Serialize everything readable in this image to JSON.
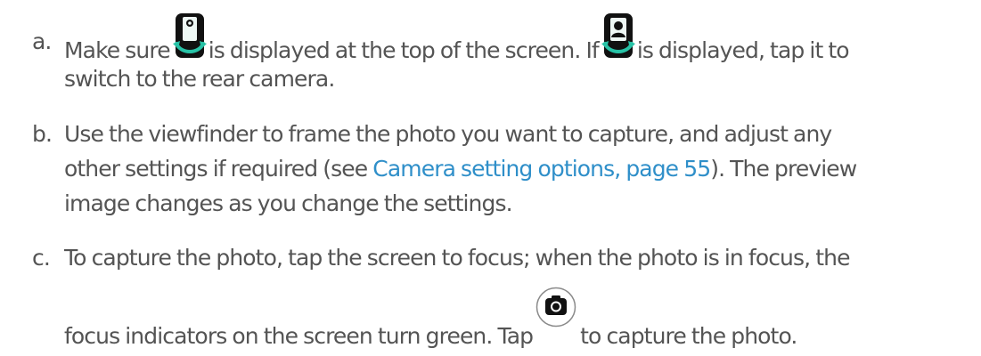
{
  "steps": [
    {
      "marker": "a.",
      "line1": {
        "part1": "Make sure",
        "part2": "is displayed at the top of the screen. If",
        "part3": "is displayed, tap it to"
      },
      "line2": "switch to the rear camera.",
      "icons": [
        "rear-camera-switch-icon",
        "front-camera-switch-icon"
      ]
    },
    {
      "marker": "b.",
      "line1": "Use the viewfinder to frame the photo you want to capture, and adjust any",
      "line2": {
        "part1": "other settings if required (see",
        "link": "Camera setting options, page 55",
        "part2": "). The preview"
      },
      "line3": "image changes as you change the settings."
    },
    {
      "marker": "c.",
      "line1": "To capture the photo, tap the screen to focus; when the photo is in focus, the",
      "line2": {
        "part1": "focus indicators on the screen turn green. Tap",
        "part2": "to capture the photo."
      },
      "icons": [
        "capture-photo-icon"
      ]
    }
  ],
  "colors": {
    "text": "#545454",
    "link": "#2f8fc9"
  }
}
